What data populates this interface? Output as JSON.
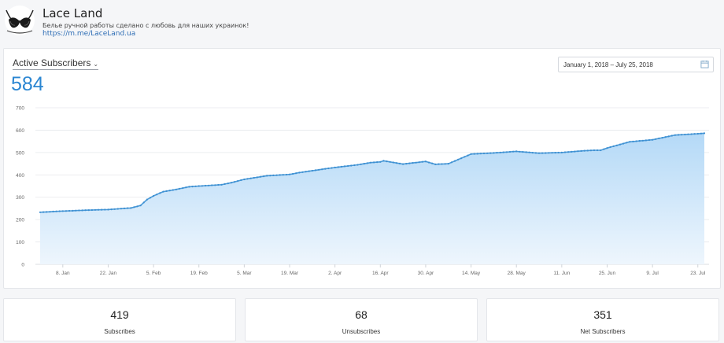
{
  "header": {
    "page_name": "Lace Land",
    "description": "Белье ручной работы сделано с любовь для наших украинок!",
    "link": "https://m.me/LaceLand.ua"
  },
  "metric": {
    "selected": "Active Subscribers",
    "value": "584"
  },
  "date_range": "January 1, 2018 – July 25, 2018",
  "icons": {
    "logo": "lace-bra-logo-icon",
    "dropdown": "chevron-down-icon",
    "calendar": "calendar-icon"
  },
  "colors": {
    "accent": "#2b86d2",
    "line": "#4a9ad8",
    "area_top": "#b4d9f7",
    "area_bottom": "#eef6fd"
  },
  "chart_data": {
    "type": "area",
    "title": "",
    "xlabel": "",
    "ylabel": "",
    "ylim": [
      0,
      700
    ],
    "yticks": [
      0,
      100,
      200,
      300,
      400,
      500,
      600,
      700
    ],
    "xticks": [
      "8. Jan",
      "22. Jan",
      "5. Feb",
      "19. Feb",
      "5. Mar",
      "19. Mar",
      "2. Apr",
      "16. Apr",
      "30. Apr",
      "14. May",
      "28. May",
      "11. Jun",
      "25. Jun",
      "9. Jul",
      "23. Jul"
    ],
    "grid": true,
    "series": [
      {
        "x": [
          "2018-01-01",
          "2018-01-08",
          "2018-01-15",
          "2018-01-22",
          "2018-01-29",
          "2018-02-01",
          "2018-02-03",
          "2018-02-05",
          "2018-02-08",
          "2018-02-12",
          "2018-02-16",
          "2018-02-19",
          "2018-02-26",
          "2018-03-01",
          "2018-03-05",
          "2018-03-12",
          "2018-03-19",
          "2018-03-22",
          "2018-03-29",
          "2018-04-02",
          "2018-04-09",
          "2018-04-13",
          "2018-04-16",
          "2018-04-17",
          "2018-04-23",
          "2018-04-24",
          "2018-04-30",
          "2018-05-03",
          "2018-05-04",
          "2018-05-07",
          "2018-05-14",
          "2018-05-21",
          "2018-05-28",
          "2018-06-04",
          "2018-06-11",
          "2018-06-18",
          "2018-06-21",
          "2018-06-23",
          "2018-06-25",
          "2018-07-02",
          "2018-07-06",
          "2018-07-09",
          "2018-07-12",
          "2018-07-16",
          "2018-07-23",
          "2018-07-25"
        ],
        "values": [
          233,
          238,
          242,
          245,
          252,
          263,
          290,
          306,
          325,
          335,
          347,
          350,
          356,
          365,
          380,
          396,
          402,
          410,
          425,
          433,
          445,
          455,
          458,
          463,
          448,
          450,
          460,
          447,
          448,
          450,
          493,
          498,
          505,
          497,
          500,
          508,
          510,
          510,
          520,
          548,
          553,
          557,
          566,
          578,
          584,
          586
        ]
      }
    ]
  },
  "stats": [
    {
      "value": "419",
      "label": "Subscribes"
    },
    {
      "value": "68",
      "label": "Unsubscribes"
    },
    {
      "value": "351",
      "label": "Net Subscribers"
    }
  ]
}
